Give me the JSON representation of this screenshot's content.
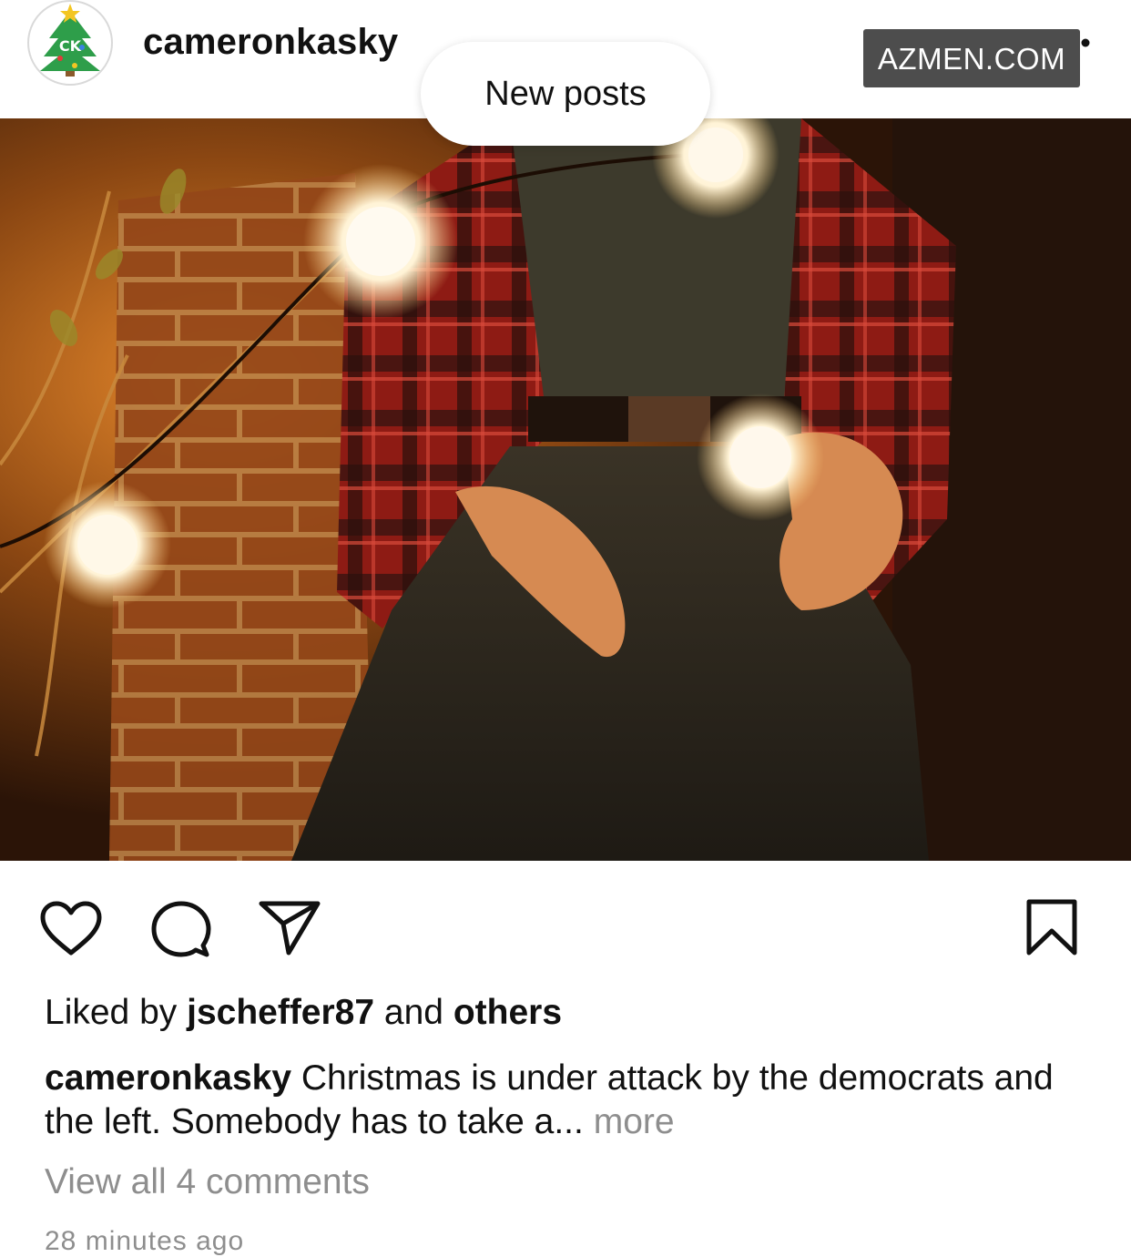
{
  "header": {
    "username": "cameronkasky",
    "avatar_icon": "christmas-tree-icon",
    "avatar_initials": "CK",
    "more_icon": "more-dots-icon"
  },
  "watermark": {
    "text": "AZMEN.COM"
  },
  "banner": {
    "new_posts_label": "New posts"
  },
  "post": {
    "actions": {
      "like_icon": "heart-icon",
      "comment_icon": "comment-icon",
      "share_icon": "paper-plane-icon",
      "save_icon": "bookmark-icon"
    },
    "likes": {
      "prefix": "Liked by",
      "user": "jscheffer87",
      "conjunction": "and",
      "others": "others"
    },
    "caption": {
      "username": "cameronkasky",
      "text": "Christmas is under attack by the democrats and the left. Somebody has to take a...",
      "more_label": "more"
    },
    "view_comments": "View all 4 comments",
    "timestamp": "28 minutes ago"
  }
}
